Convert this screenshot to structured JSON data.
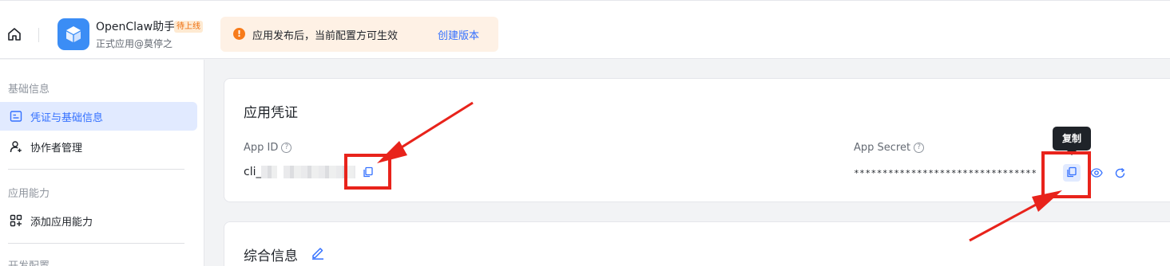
{
  "header": {
    "app_name": "OpenClaw助手",
    "app_badge": "待上线",
    "app_sub": "正式应用@莫停之",
    "notice_text": "应用发布后，当前配置方可生效",
    "notice_icon": "!",
    "notice_link": "创建版本"
  },
  "sidebar": {
    "group_basic": "基础信息",
    "item_credentials": "凭证与基础信息",
    "item_collaborators": "协作者管理",
    "group_capability": "应用能力",
    "item_add_capability": "添加应用能力",
    "group_dev": "开发配置"
  },
  "credentials": {
    "title": "应用凭证",
    "app_id_label": "App ID",
    "app_id_prefix": "cli_",
    "app_secret_label": "App Secret",
    "secret_mask": "********************************",
    "tooltip": "复制"
  },
  "info": {
    "title": "综合信息"
  },
  "colors": {
    "accent": "#3370ff",
    "annotation": "#e8231b"
  },
  "icons": [
    "home-icon",
    "app-logo-icon",
    "warning-icon",
    "credential-icon",
    "add-user-icon",
    "grid-plus-icon",
    "question-icon",
    "copy-icon",
    "eye-icon",
    "refresh-icon",
    "edit-icon"
  ]
}
